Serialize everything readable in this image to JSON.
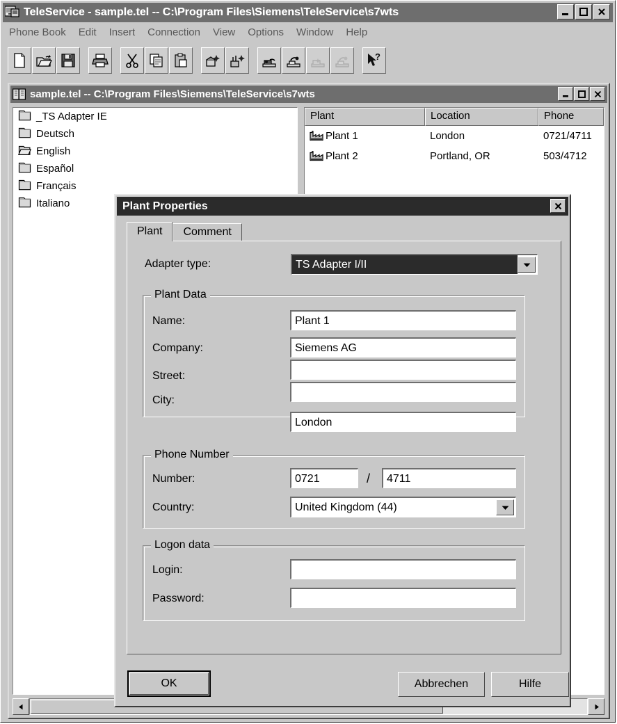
{
  "app": {
    "title": "TeleService - sample.tel -- C:\\Program Files\\Siemens\\TeleService\\s7wts",
    "icon": "teleservice-app-icon",
    "window_buttons": [
      {
        "name": "minimize",
        "glyph": "_"
      },
      {
        "name": "maximize",
        "glyph": "□"
      },
      {
        "name": "close",
        "glyph": "✕"
      }
    ]
  },
  "menu": {
    "items": [
      {
        "label": "Phone Book",
        "accel_index": 4
      },
      {
        "label": "Edit",
        "accel_index": 1
      },
      {
        "label": "Insert",
        "accel_index": 0
      },
      {
        "label": "Connection",
        "accel_index": 0
      },
      {
        "label": "View",
        "accel_index": 0
      },
      {
        "label": "Options",
        "accel_index": 0
      },
      {
        "label": "Window",
        "accel_index": 0
      },
      {
        "label": "Help",
        "accel_index": 0
      }
    ]
  },
  "toolbar": {
    "buttons": [
      {
        "name": "new-icon",
        "tip": "New"
      },
      {
        "name": "open-folder-icon",
        "tip": "Open"
      },
      {
        "name": "save-floppy-icon",
        "tip": "Save"
      },
      {
        "name": "print-icon",
        "tip": "Print"
      },
      {
        "name": "cut-scissors-icon",
        "tip": "Cut"
      },
      {
        "name": "copy-icon",
        "tip": "Copy"
      },
      {
        "name": "paste-icon",
        "tip": "Paste"
      },
      {
        "name": "new-plant-icon",
        "tip": "New Plant"
      },
      {
        "name": "new-connection-icon",
        "tip": "New Connection"
      },
      {
        "name": "connect-icon",
        "tip": "Connect"
      },
      {
        "name": "disconnect-icon",
        "tip": "Disconnect"
      },
      {
        "name": "connect-disabled-icon",
        "tip": "Connect (disabled)"
      },
      {
        "name": "disconnect-disabled-icon",
        "tip": "Disconnect (disabled)"
      },
      {
        "name": "context-help-icon",
        "tip": "Context Help"
      }
    ]
  },
  "mdi": {
    "title": "sample.tel -- C:\\Program Files\\Siemens\\TeleService\\s7wts",
    "icon": "phone-book-icon",
    "window_buttons": [
      {
        "name": "minimize",
        "glyph": "_"
      },
      {
        "name": "maximize",
        "glyph": "□"
      },
      {
        "name": "close",
        "glyph": "✕"
      }
    ],
    "tree": {
      "items": [
        {
          "label": "_TS Adapter IE",
          "icon": "folder-closed-icon"
        },
        {
          "label": "Deutsch",
          "icon": "folder-closed-icon"
        },
        {
          "label": "English",
          "icon": "folder-open-icon"
        },
        {
          "label": "Español",
          "icon": "folder-closed-icon"
        },
        {
          "label": "Français",
          "icon": "folder-closed-icon"
        },
        {
          "label": "Italiano",
          "icon": "folder-closed-icon"
        }
      ]
    },
    "list": {
      "columns": [
        "Plant",
        "Location",
        "Phone"
      ],
      "rows": [
        {
          "plant": "Plant 1",
          "location": "London",
          "phone": "0721/4711",
          "icon": "factory-icon"
        },
        {
          "plant": "Plant 2",
          "location": "Portland, OR",
          "phone": "503/4712",
          "icon": "factory-icon"
        }
      ]
    }
  },
  "dialog": {
    "title": "Plant Properties",
    "close_glyph": "✕",
    "tabs": [
      {
        "label": "Plant",
        "active": true
      },
      {
        "label": "Comment",
        "active": false
      }
    ],
    "adapter": {
      "label": "Adapter type:",
      "value": "TS Adapter I/II",
      "selected": true
    },
    "plant_data": {
      "title": "Plant Data",
      "name_label": "Name:",
      "name_value": "Plant 1",
      "company_label": "Company:",
      "company_value": "Siemens AG",
      "company_value2": "",
      "street_label": "Street:",
      "street_value": "",
      "city_label": "City:",
      "city_value": "London"
    },
    "phone": {
      "title": "Phone Number",
      "number_label": "Number:",
      "area_code": "0721",
      "separator": "/",
      "subscriber": "4711",
      "country_label": "Country:",
      "country_value": "United Kingdom (44)"
    },
    "logon": {
      "title": "Logon data",
      "login_label": "Login:",
      "login_value": "",
      "password_label": "Password:",
      "password_value": ""
    },
    "buttons": {
      "ok": "OK",
      "cancel": "Abbrechen",
      "help": "Hilfe"
    }
  },
  "colors": {
    "face": "#c8c8c8",
    "titlebar_active": "#6e6e6e",
    "dialog_titlebar": "#2b2b2b",
    "field_bg": "#ffffff",
    "selection_bg": "#2b2b2b",
    "selection_fg": "#ffffff"
  }
}
